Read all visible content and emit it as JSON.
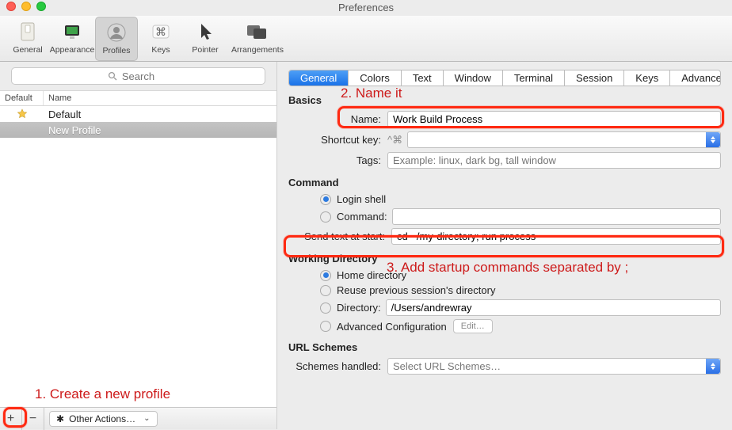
{
  "window": {
    "title": "Preferences"
  },
  "toolbar": {
    "items": [
      "General",
      "Appearance",
      "Profiles",
      "Keys",
      "Pointer",
      "Arrangements"
    ],
    "selected": "Profiles"
  },
  "sidebar": {
    "search_placeholder": "Search",
    "cols": [
      "Default",
      "Name"
    ],
    "rows": [
      {
        "default": true,
        "name": "Default"
      },
      {
        "default": false,
        "name": "New Profile",
        "selected": true
      }
    ],
    "other_actions": "Other Actions…"
  },
  "tabs": [
    "General",
    "Colors",
    "Text",
    "Window",
    "Terminal",
    "Session",
    "Keys",
    "Advanced"
  ],
  "tab_selected": "General",
  "basics": {
    "head": "Basics",
    "name_label": "Name:",
    "name_value": "Work Build Process",
    "shortcut_label": "Shortcut key:",
    "shortcut_value": "^⌘",
    "tags_label": "Tags:",
    "tags_placeholder": "Example: linux, dark bg, tall window"
  },
  "command": {
    "head": "Command",
    "login_shell": "Login shell",
    "command_label": "Command:",
    "command_value": "",
    "send_label": "Send text at start:",
    "send_value": "cd ~/my-directory; run process"
  },
  "workdir": {
    "head": "Working Directory",
    "home": "Home directory",
    "reuse": "Reuse previous session's directory",
    "dir_label": "Directory:",
    "dir_value": "/Users/andrewray",
    "adv": "Advanced Configuration",
    "edit": "Edit…"
  },
  "url": {
    "head": "URL Schemes",
    "label": "Schemes handled:",
    "value": "Select URL Schemes…"
  },
  "annotations": {
    "a1": "1. Create a new profile",
    "a2": "2. Name it",
    "a3": "3. Add startup commands separated by ;"
  }
}
